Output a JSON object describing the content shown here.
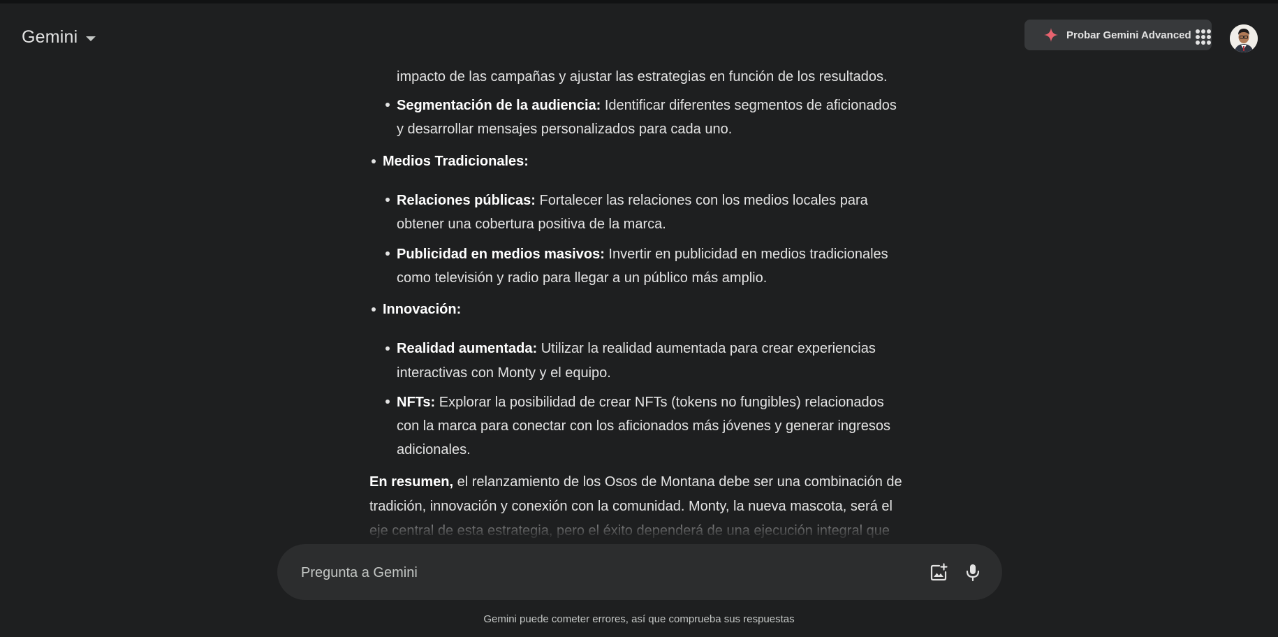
{
  "header": {
    "title": "Gemini",
    "advanced_label": "Probar Gemini Advanced",
    "accent_color": "#e8636f"
  },
  "response": {
    "lines": [
      {
        "bold": "",
        "text": "impacto de las campañas y ajustar las estrategias en función de los resultados."
      },
      {
        "bold": "Segmentación de la audiencia:",
        "text": " Identificar diferentes segmentos de aficionados"
      },
      {
        "bold": "",
        "text": "y desarrollar mensajes personalizados para cada uno."
      },
      {
        "bold": "Medios Tradicionales:",
        "text": ""
      },
      {
        "bold": "Relaciones públicas:",
        "text": " Fortalecer las relaciones con los medios locales para"
      },
      {
        "bold": "",
        "text": "obtener una cobertura positiva de la marca."
      },
      {
        "bold": "Publicidad en medios masivos:",
        "text": " Invertir en publicidad en medios tradicionales"
      },
      {
        "bold": "",
        "text": "como televisión y radio para llegar a un público más amplio."
      },
      {
        "bold": "Innovación:",
        "text": ""
      },
      {
        "bold": "Realidad aumentada:",
        "text": " Utilizar la realidad aumentada para crear experiencias"
      },
      {
        "bold": "",
        "text": "interactivas con Monty y el equipo."
      },
      {
        "bold": "NFTs:",
        "text": " Explorar la posibilidad de crear NFTs (tokens no fungibles) relacionados"
      },
      {
        "bold": "",
        "text": "con la marca para conectar con los aficionados más jóvenes y generar ingresos"
      },
      {
        "bold": "",
        "text": "adicionales."
      },
      {
        "bold": "En resumen,",
        "text": " el relanzamiento de los Osos de Montana debe ser una combinación de"
      },
      {
        "bold": "",
        "text": "tradición, innovación y conexión con la comunidad. Monty, la nueva mascota, será el"
      },
      {
        "bold": "",
        "text": "eje central de esta estrategia, pero el éxito dependerá de una ejecución integral que"
      }
    ]
  },
  "prompt": {
    "placeholder": "Pregunta a Gemini",
    "value": ""
  },
  "footer": {
    "disclaimer": "Gemini puede cometer errores, así que comprueba sus respuestas"
  },
  "icons": {
    "spark": "spark-icon",
    "apps": "apps-grid-icon",
    "image_add": "image-add-icon",
    "mic": "mic-icon",
    "dropdown": "chevron-down-icon"
  }
}
